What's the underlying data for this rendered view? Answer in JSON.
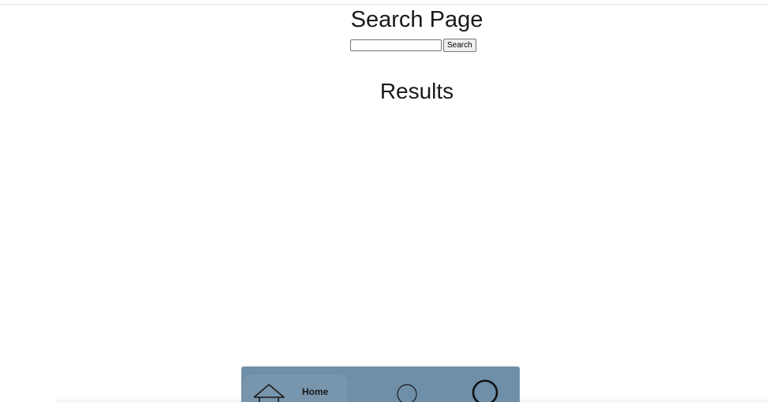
{
  "header": {
    "title": "Search Page"
  },
  "search": {
    "value": "",
    "placeholder": "",
    "button_label": "Search"
  },
  "results": {
    "title": "Results"
  },
  "bottom_nav": {
    "background": "#6f8fa8",
    "items": [
      {
        "label": "Home",
        "icon": "home-icon"
      },
      {
        "label": "",
        "icon": "circle-outline-icon"
      },
      {
        "label": "",
        "icon": "circle-bold-icon"
      }
    ]
  }
}
